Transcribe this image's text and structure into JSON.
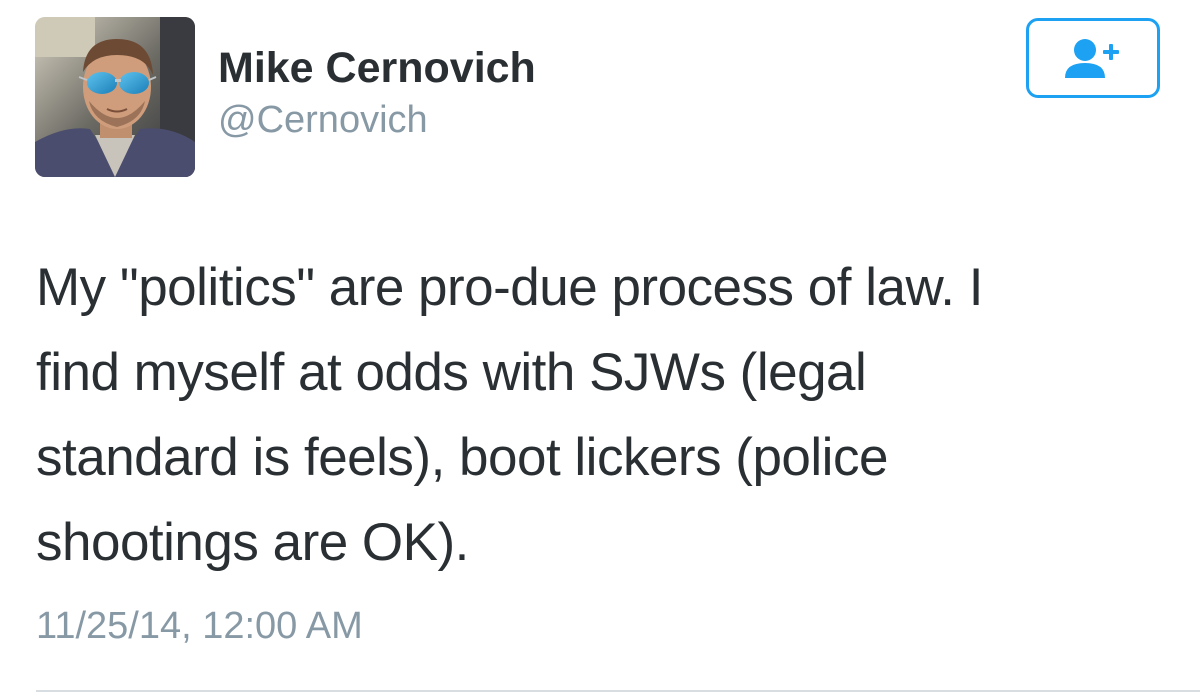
{
  "author": {
    "name": "Mike Cernovich",
    "handle": "@Cernovich",
    "avatar_alt": "profile-photo"
  },
  "follow_button": {
    "icon": "add-user-icon",
    "color": "#1da1f2"
  },
  "tweet": {
    "lines": [
      "My \"politics\" are pro-due process of law. I",
      "find myself at odds with SJWs (legal",
      "standard is feels), boot lickers (police",
      "shootings are OK)."
    ],
    "timestamp": "11/25/14, 12:00 AM"
  },
  "colors": {
    "text": "#292f33",
    "muted": "#8899a6",
    "accent": "#1da1f2"
  }
}
